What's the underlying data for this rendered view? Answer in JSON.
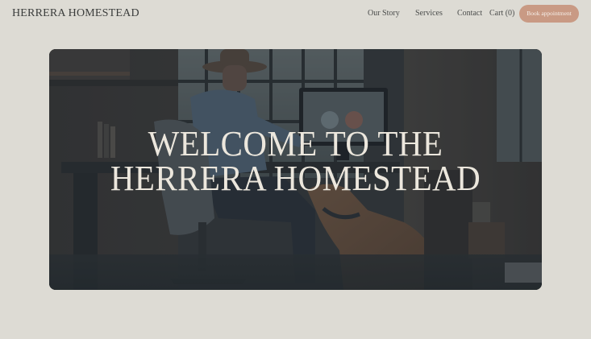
{
  "header": {
    "brand": "HERRERA HOMESTEAD",
    "nav": {
      "our_story": "Our Story",
      "services": "Services",
      "contact": "Contact",
      "cart": "Cart (0)"
    },
    "book_button": "Book appointment"
  },
  "hero": {
    "title_line1": "WELCOME TO THE",
    "title_line2": "HERRERA HOMESTEAD",
    "image_description_icon": "photo-man-at-desk-with-dog"
  },
  "colors": {
    "background": "#dddbd4",
    "accent_button": "#c99a84",
    "hero_text": "#ece7dd"
  }
}
